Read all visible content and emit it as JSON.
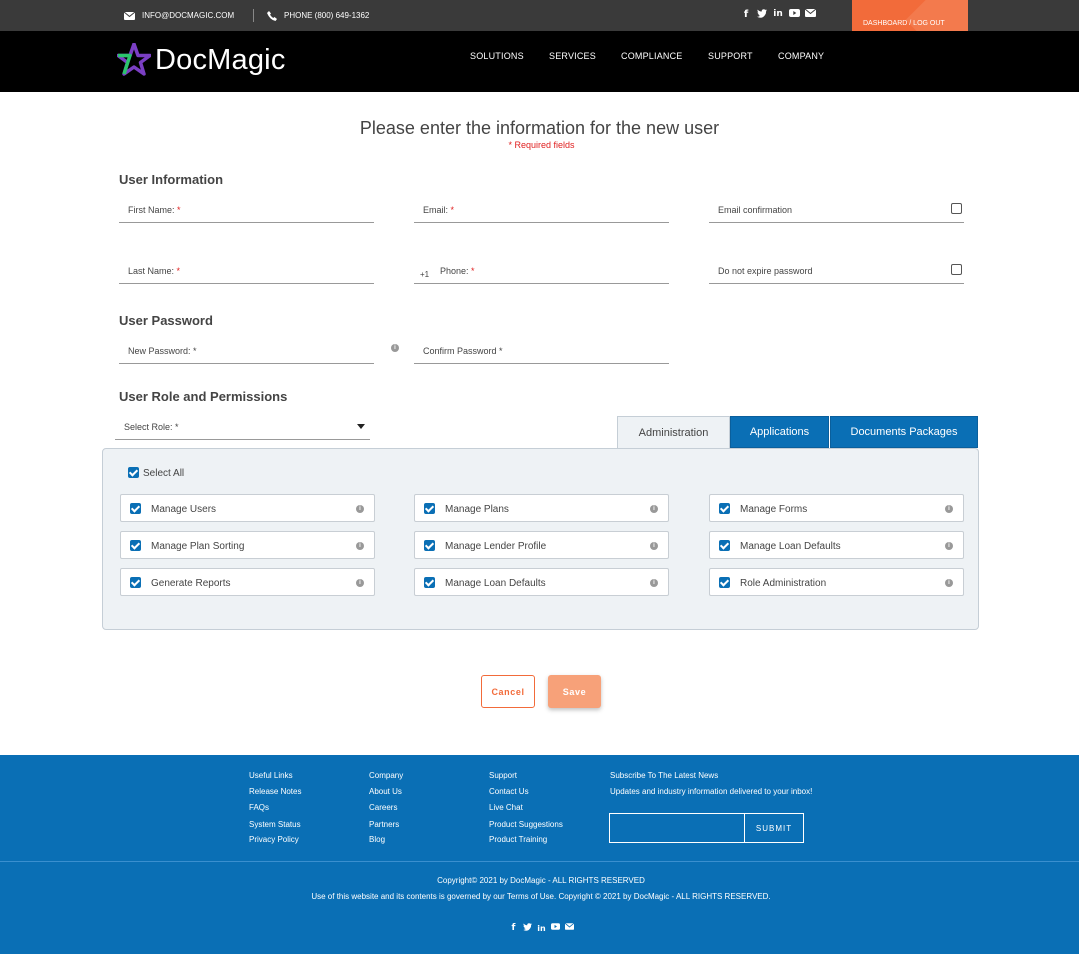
{
  "topbar": {
    "email": "INFO@DOCMAGIC.COM",
    "phone": "PHONE (800) 649-1362",
    "dashboard": "DASHBOARD / LOG OUT",
    "social": [
      "facebook-icon",
      "twitter-icon",
      "linkedin-icon",
      "youtube-icon",
      "mail-icon"
    ]
  },
  "nav": {
    "logo": "DocMagic",
    "items": [
      "SOLUTIONS",
      "SERVICES",
      "COMPLIANCE",
      "SUPPORT",
      "COMPANY"
    ]
  },
  "main": {
    "title": "Please enter the information for the new user",
    "required_note": "* Required fields",
    "user_info": {
      "heading": "User Information",
      "first_name": "First Name:",
      "email": "Email:",
      "email_confirmation": "Email confirmation",
      "last_name": "Last Name:",
      "phone_prefix": "+1",
      "phone": "Phone:",
      "no_expire": "Do not expire password",
      "required_mark": "*"
    },
    "password": {
      "heading": "User Password",
      "new": "New Password: *",
      "confirm": "Confirm Password *"
    },
    "roles": {
      "heading": "User Role and Permissions",
      "select_role": "Select Role: *",
      "tabs": [
        "Administration",
        "Applications",
        "Documents Packages"
      ],
      "select_all": "Select All",
      "permissions": [
        [
          "Manage Users",
          "Manage Plans",
          "Manage Forms"
        ],
        [
          "Manage Plan Sorting",
          "Manage Lender Profile",
          "Manage Loan Defaults"
        ],
        [
          "Generate Reports",
          "Manage Loan Defaults",
          "Role Administration"
        ]
      ]
    },
    "buttons": {
      "cancel": "Cancel",
      "save": "Save"
    }
  },
  "footer": {
    "col1": [
      "Useful Links",
      "Release Notes",
      "FAQs",
      "System Status",
      "Privacy Policy"
    ],
    "col2": [
      "Company",
      "About Us",
      "Careers",
      "Partners",
      "Blog"
    ],
    "col3": [
      "Support",
      "Contact Us",
      "Live Chat",
      "Product Suggestions",
      "Product Training"
    ],
    "subscribe_title": "Subscribe To The Latest News",
    "subscribe_text": "Updates and industry information delivered to your inbox!",
    "submit": "SUBMIT",
    "copyright1": "Copyright© 2021 by DocMagic - ALL RIGHTS RESERVED",
    "copyright2": "Use of this website and its contents is governed by our Terms of Use. Copyright © 2021 by DocMagic - ALL RIGHTS RESERVED."
  },
  "colors": {
    "accent": "#f26b3a",
    "brand_blue": "#0a6fb5",
    "nav": "#000000",
    "topbar": "#3a3a3a"
  }
}
